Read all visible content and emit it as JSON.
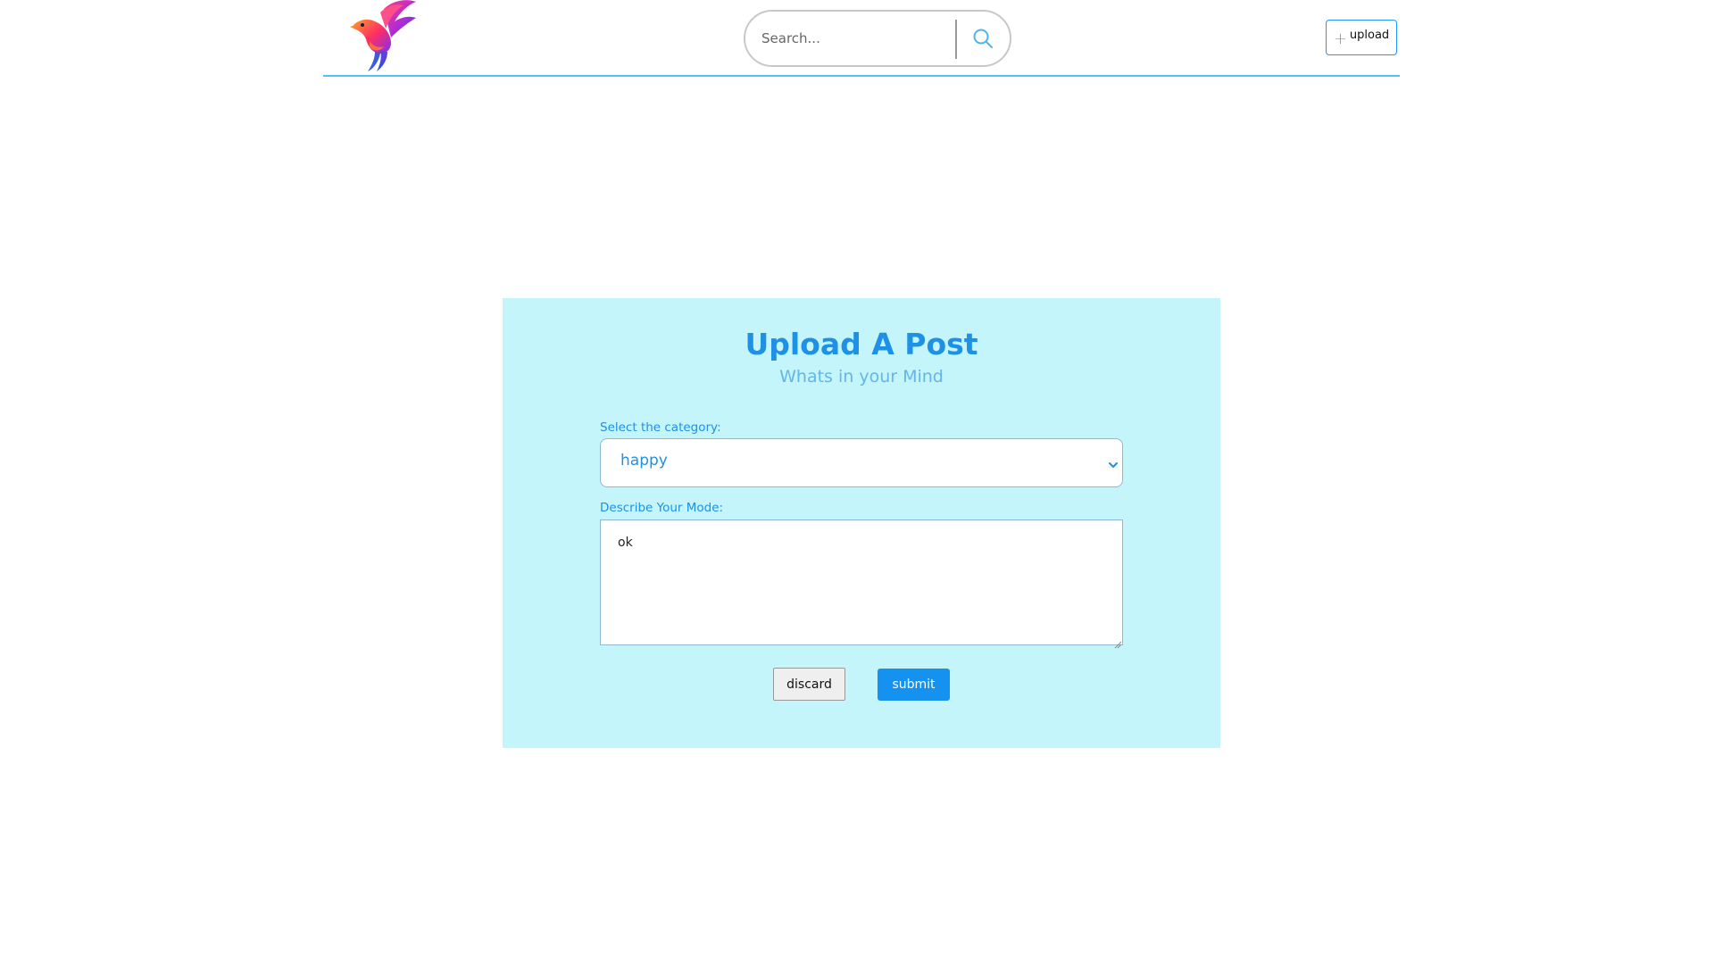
{
  "header": {
    "logo": "bird-logo",
    "search": {
      "placeholder": "Search...",
      "value": "",
      "icon": "search-icon"
    },
    "upload_button": {
      "icon": "plus-icon",
      "icon_glyph": "+",
      "label": "upload"
    }
  },
  "form": {
    "title": "Upload A Post",
    "subtitle": "Whats in your Mind",
    "category": {
      "label": "Select the category:",
      "selected": "happy",
      "icon": "chevron-down-icon"
    },
    "mode": {
      "label": "Describe Your Mode:",
      "value": "ok"
    },
    "discard_label": "discard",
    "submit_label": "submit"
  },
  "colors": {
    "accent": "#1e90e6",
    "card_background": "#c4f5fa",
    "header_divider": "#4fc3f7",
    "submit_background": "#1591f0"
  }
}
